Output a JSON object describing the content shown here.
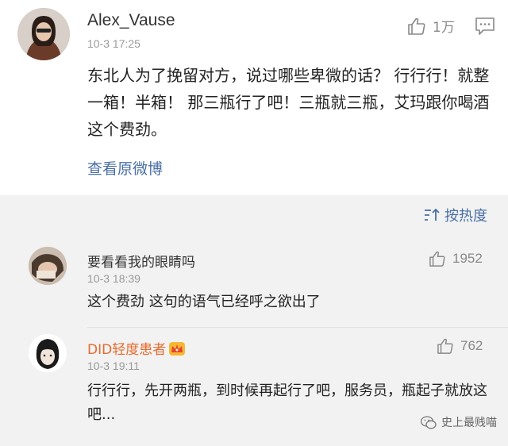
{
  "post": {
    "username": "Alex_Vause",
    "time": "10-3 17:25",
    "like_count": "1万",
    "text": "东北人为了挽留对方，说过哪些卑微的话？ 行行行！就整一箱！半箱！ 那三瓶行了吧！三瓶就三瓶，艾玛跟你喝酒这个费劲。",
    "view_original": "查看原微博"
  },
  "sort": {
    "label": "按热度"
  },
  "comments": [
    {
      "username": "要看看我的眼睛吗",
      "time": "10-3 18:39",
      "likes": "1952",
      "text": "这个费劲 这句的语气已经呼之欲出了"
    },
    {
      "username": "DID轻度患者",
      "time": "10-3 19:11",
      "likes": "762",
      "text": "行行行，先开两瓶，到时候再起行了吧，服务员，瓶起子就放这吧..."
    }
  ],
  "watermark": {
    "text": "史上最贱喵"
  },
  "colors": {
    "link": "#4a6fa5",
    "vip_name": "#e66b2d"
  }
}
